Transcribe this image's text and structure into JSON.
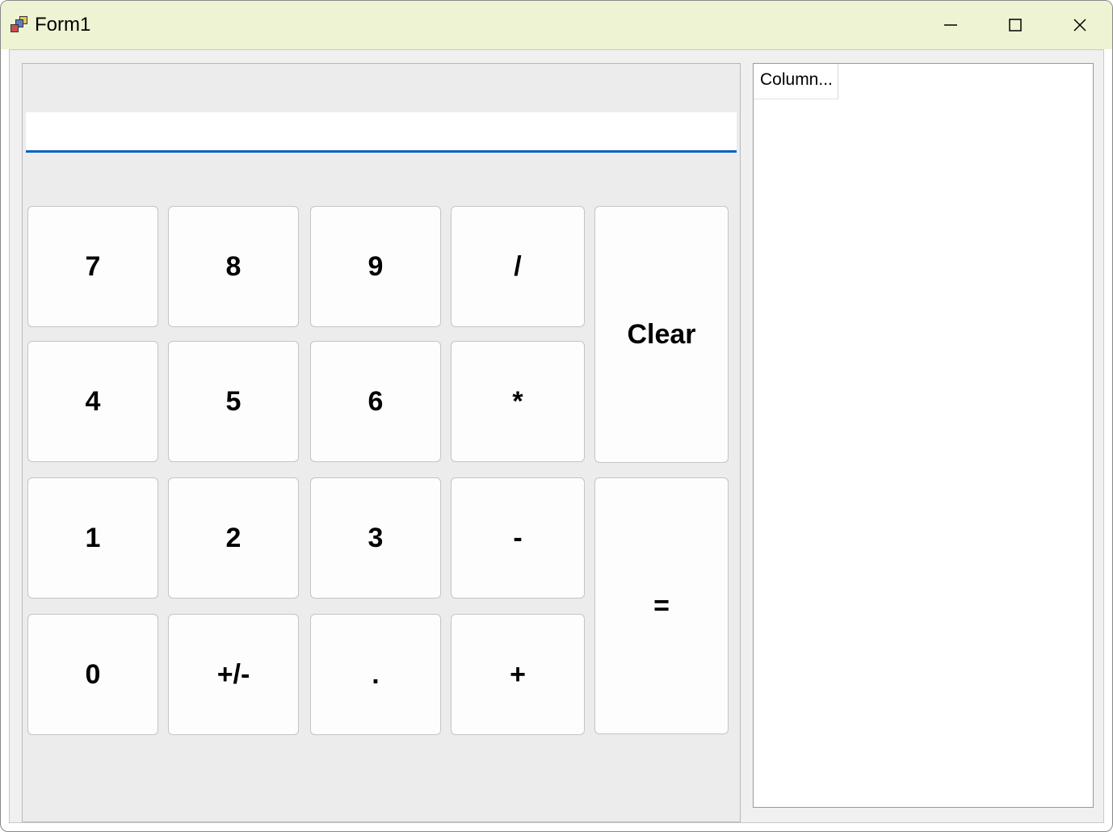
{
  "window": {
    "title": "Form1"
  },
  "display": {
    "value": ""
  },
  "keys": {
    "k7": "7",
    "k8": "8",
    "k9": "9",
    "k4": "4",
    "k5": "5",
    "k6": "6",
    "k1": "1",
    "k2": "2",
    "k3": "3",
    "k0": "0",
    "sign": "+/-",
    "dot": ".",
    "div": "/",
    "mul": "*",
    "sub": "-",
    "add": "+",
    "clear": "Clear",
    "eq": "="
  },
  "history": {
    "column_header": "Column..."
  }
}
